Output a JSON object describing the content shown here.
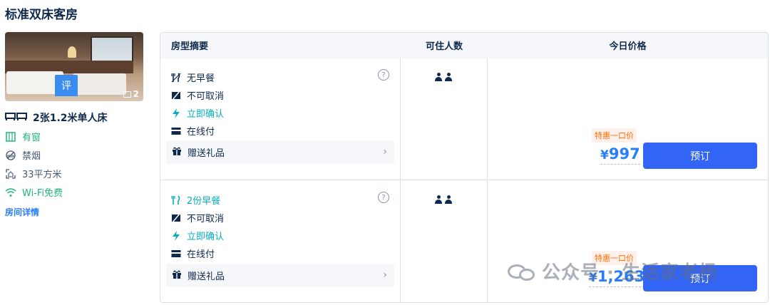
{
  "room": {
    "title": "标准双床客房",
    "photo_count": "2",
    "review_badge": "评",
    "bed": "2张1.2米单人床",
    "features": [
      "有窗",
      "禁烟",
      "33平方米",
      "Wi-Fi免费"
    ],
    "details_link": "房间详情"
  },
  "table": {
    "headers": {
      "summary": "房型摘要",
      "guests": "可住人数",
      "price": "今日价格"
    },
    "rows": [
      {
        "breakfast": "无早餐",
        "cancel": "不可取消",
        "confirm": "立即确认",
        "payment": "在线付",
        "gift": "赠送礼品",
        "help": "?",
        "deal_tag": "特惠一口价",
        "currency": "¥",
        "price": "997",
        "book": "预订",
        "guest_count": 2
      },
      {
        "breakfast": "2份早餐",
        "cancel": "不可取消",
        "confirm": "立即确认",
        "payment": "在线付",
        "gift": "赠送礼品",
        "help": "?",
        "deal_tag": "特惠一口价",
        "currency": "¥",
        "price": "1,263",
        "book": "预订",
        "guest_count": 2
      }
    ]
  },
  "watermark": "公众号 · 生活家老杨",
  "colors": {
    "accent": "#287dfa",
    "button": "#3264f6",
    "deal": "#ff6f00",
    "green": "#06aebd"
  }
}
